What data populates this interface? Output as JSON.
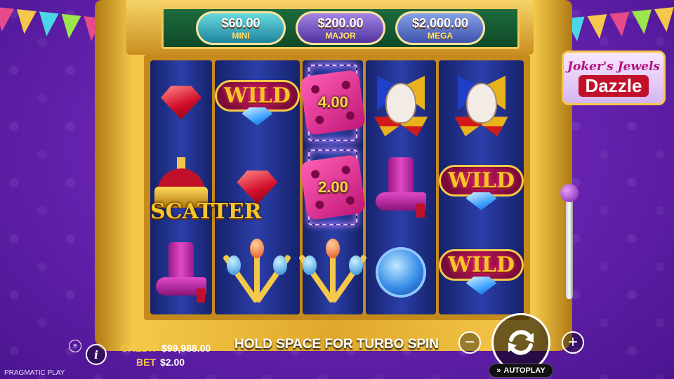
{
  "jackpots": [
    {
      "amount": "$60.00",
      "label": "MINI"
    },
    {
      "amount": "$200.00",
      "label": "MAJOR"
    },
    {
      "amount": "$2,000.00",
      "label": "MEGA"
    }
  ],
  "logo": {
    "line1": "Joker's Jewels",
    "line2": "Dazzle"
  },
  "reels": [
    [
      "red-gem",
      "scatter-crown",
      "boot"
    ],
    [
      "wild",
      "red-gem",
      "scepters"
    ],
    [
      "dice",
      "dice",
      "scepters"
    ],
    [
      "joker",
      "boot",
      "blue-gem"
    ],
    [
      "joker",
      "wild",
      "wild"
    ]
  ],
  "symbols": {
    "wild_label": "WILD",
    "scatter_label": "SCATTER",
    "dice_values": [
      "4.00",
      "2.00"
    ]
  },
  "footer": {
    "credit_label": "CREDIT",
    "credit_value": "$99,988.00",
    "bet_label": "BET",
    "bet_value": "$2.00",
    "message": "HOLD SPACE FOR TURBO SPIN",
    "autoplay_label": "AUTOPLAY",
    "brand": "PRAGMATIC PLAY",
    "info_glyph": "i",
    "minus_glyph": "−",
    "plus_glyph": "+"
  },
  "colors": {
    "background": "#6a24b3",
    "gold": "#f4c84a",
    "reel_blue": "#2b3fa8",
    "jackpot_panel": "#0f4a28"
  }
}
